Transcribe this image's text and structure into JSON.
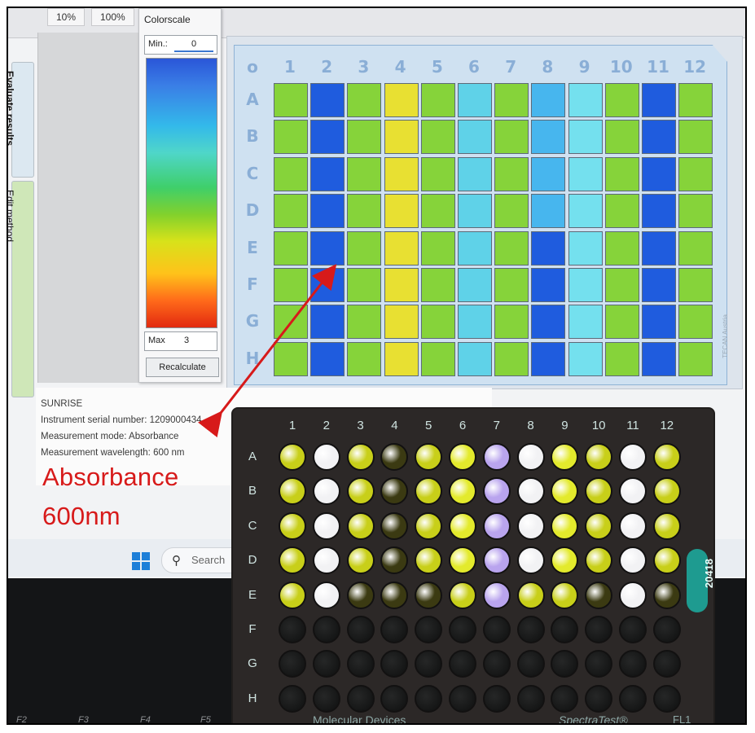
{
  "toolbar": {
    "zoom_a": "10%",
    "zoom_b": "100%"
  },
  "sidetabs": {
    "evaluate": "Evaluate results",
    "edit": "Edit method"
  },
  "colorscale": {
    "title": "Colorscale",
    "min_label": "Min.:",
    "min_value": "0",
    "max_label": "Max",
    "max_value": "3",
    "button": "Recalculate"
  },
  "digital_plate": {
    "corner": "o",
    "columns": [
      "1",
      "2",
      "3",
      "4",
      "5",
      "6",
      "7",
      "8",
      "9",
      "10",
      "11",
      "12"
    ],
    "rows": [
      "A",
      "B",
      "C",
      "D",
      "E",
      "F",
      "G",
      "H"
    ],
    "vendor_mark": "TECAN Austria",
    "colors": {
      "g": "#86d33a",
      "b": "#1f5cde",
      "y": "#e8e032",
      "c": "#5fd2e8",
      "s": "#47b6ee",
      "t": "#74e0ee",
      "m": "#3a8ae8"
    },
    "wells": [
      [
        "g",
        "b",
        "g",
        "y",
        "g",
        "c",
        "g",
        "s",
        "t",
        "g",
        "b",
        "g"
      ],
      [
        "g",
        "b",
        "g",
        "y",
        "g",
        "c",
        "g",
        "s",
        "t",
        "g",
        "b",
        "g"
      ],
      [
        "g",
        "b",
        "g",
        "y",
        "g",
        "c",
        "g",
        "s",
        "t",
        "g",
        "b",
        "g"
      ],
      [
        "g",
        "b",
        "g",
        "y",
        "g",
        "c",
        "g",
        "s",
        "t",
        "g",
        "b",
        "g"
      ],
      [
        "g",
        "b",
        "g",
        "y",
        "g",
        "c",
        "g",
        "b",
        "t",
        "g",
        "b",
        "g"
      ],
      [
        "g",
        "b",
        "g",
        "y",
        "g",
        "c",
        "g",
        "b",
        "t",
        "g",
        "b",
        "g"
      ],
      [
        "g",
        "b",
        "g",
        "y",
        "g",
        "c",
        "g",
        "b",
        "t",
        "g",
        "b",
        "g"
      ],
      [
        "g",
        "b",
        "g",
        "y",
        "g",
        "c",
        "g",
        "b",
        "t",
        "g",
        "b",
        "g"
      ]
    ]
  },
  "info": {
    "instrument": "SUNRISE",
    "serial": "Instrument serial number: 1209000434",
    "mode": "Measurement mode: Absorbance",
    "wavelength": "Measurement wavelength: 600 nm"
  },
  "taskbar": {
    "search_placeholder": "Search"
  },
  "fkeys": [
    "F2",
    "F3",
    "F4",
    "F5"
  ],
  "annotation": {
    "line1": "Absorbance",
    "line2": "600nm",
    "color": "#d71a1a"
  },
  "physical_plate": {
    "columns": [
      "1",
      "2",
      "3",
      "4",
      "5",
      "6",
      "7",
      "8",
      "9",
      "10",
      "11",
      "12"
    ],
    "rows": [
      "A",
      "B",
      "C",
      "D",
      "E",
      "F",
      "G",
      "H"
    ],
    "label": "20418",
    "maker": "Molecular Devices",
    "brand": "SpectraTest®",
    "code": "FL1",
    "colors": {
      "y": "#c8cf19",
      "d": "#3b3a12",
      "w": "#f2f2f4",
      "p": "#b9a4ee",
      "k": "#151616",
      "h": "#e3ea2c"
    },
    "wells": [
      [
        "y",
        "w",
        "y",
        "d",
        "y",
        "h",
        "p",
        "w",
        "h",
        "y",
        "w",
        "y"
      ],
      [
        "y",
        "w",
        "y",
        "d",
        "y",
        "h",
        "p",
        "w",
        "h",
        "y",
        "w",
        "y"
      ],
      [
        "y",
        "w",
        "y",
        "d",
        "y",
        "h",
        "p",
        "w",
        "h",
        "y",
        "w",
        "y"
      ],
      [
        "y",
        "w",
        "y",
        "d",
        "y",
        "h",
        "p",
        "w",
        "h",
        "y",
        "w",
        "y"
      ],
      [
        "y",
        "w",
        "d",
        "d",
        "d",
        "y",
        "p",
        "y",
        "y",
        "d",
        "w",
        "d"
      ],
      [
        "k",
        "k",
        "k",
        "k",
        "k",
        "k",
        "k",
        "k",
        "k",
        "k",
        "k",
        "k"
      ],
      [
        "k",
        "k",
        "k",
        "k",
        "k",
        "k",
        "k",
        "k",
        "k",
        "k",
        "k",
        "k"
      ],
      [
        "k",
        "k",
        "k",
        "k",
        "k",
        "k",
        "k",
        "k",
        "k",
        "k",
        "k",
        "k"
      ]
    ]
  }
}
